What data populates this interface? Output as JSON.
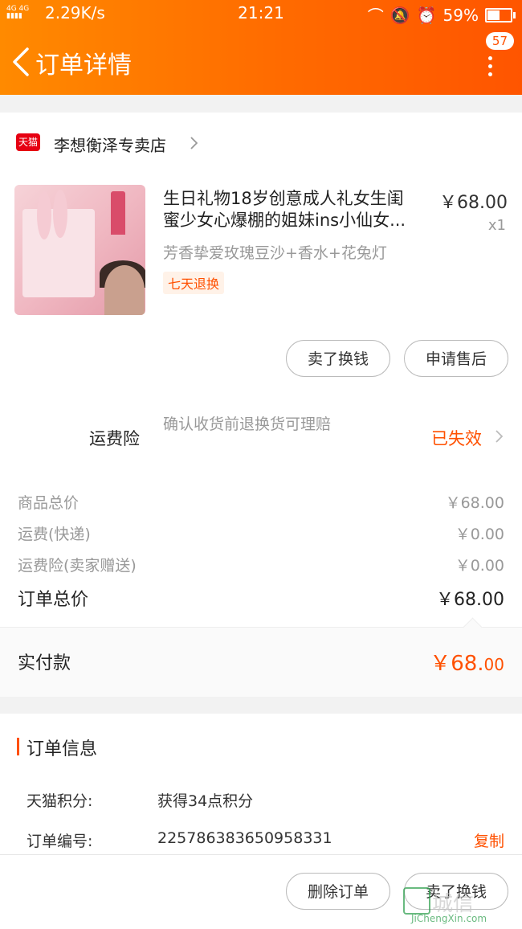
{
  "status_bar": {
    "network": "2.29K/s",
    "time": "21:21",
    "battery": "59%",
    "battery_level": 0.59
  },
  "nav": {
    "title": "订单详情",
    "badge": "57"
  },
  "shop": {
    "logo_text": "天猫",
    "name": "李想衡泽专卖店"
  },
  "product": {
    "title_line1": "生日礼物18岁创意成人礼女生闺",
    "title_line2": "蜜少女心爆棚的姐妹ins小仙女...",
    "price": "￥68.00",
    "qty": "x1",
    "sku": "芳香挚爱玫瑰豆沙+香水+花兔灯",
    "tag": "七天退换"
  },
  "item_actions": {
    "sell_label": "卖了换钱",
    "aftersale_label": "申请售后"
  },
  "insurance": {
    "label": "运费险",
    "desc": "确认收货前退换货可理赔",
    "status": "已失效"
  },
  "fees": {
    "goods_label": "商品总价",
    "goods_value": "￥68.00",
    "shipping_label": "运费(快递)",
    "shipping_value": "￥0.00",
    "ins_label": "运费险(卖家赠送)",
    "ins_value": "￥0.00",
    "total_label": "订单总价",
    "total_value": "￥68.00"
  },
  "paid": {
    "label": "实付款",
    "value_main": "￥68.",
    "value_decimal": "00"
  },
  "order_info": {
    "heading": "订单信息",
    "points_label": "天猫积分:",
    "points_value": "获得34点积分",
    "number_label": "订单编号:",
    "number_value": "225786383650958331",
    "copy_label": "复制"
  },
  "bottom_actions": {
    "delete_label": "删除订单",
    "sell_label": "卖了换钱"
  },
  "watermark": {
    "text": "城信",
    "url": "JiChengXin.com"
  },
  "colors": {
    "accent": "#ff5000",
    "header_gradient_start": "#ff8a00",
    "header_gradient_end": "#ff5500",
    "tmall_red": "#e60012"
  }
}
